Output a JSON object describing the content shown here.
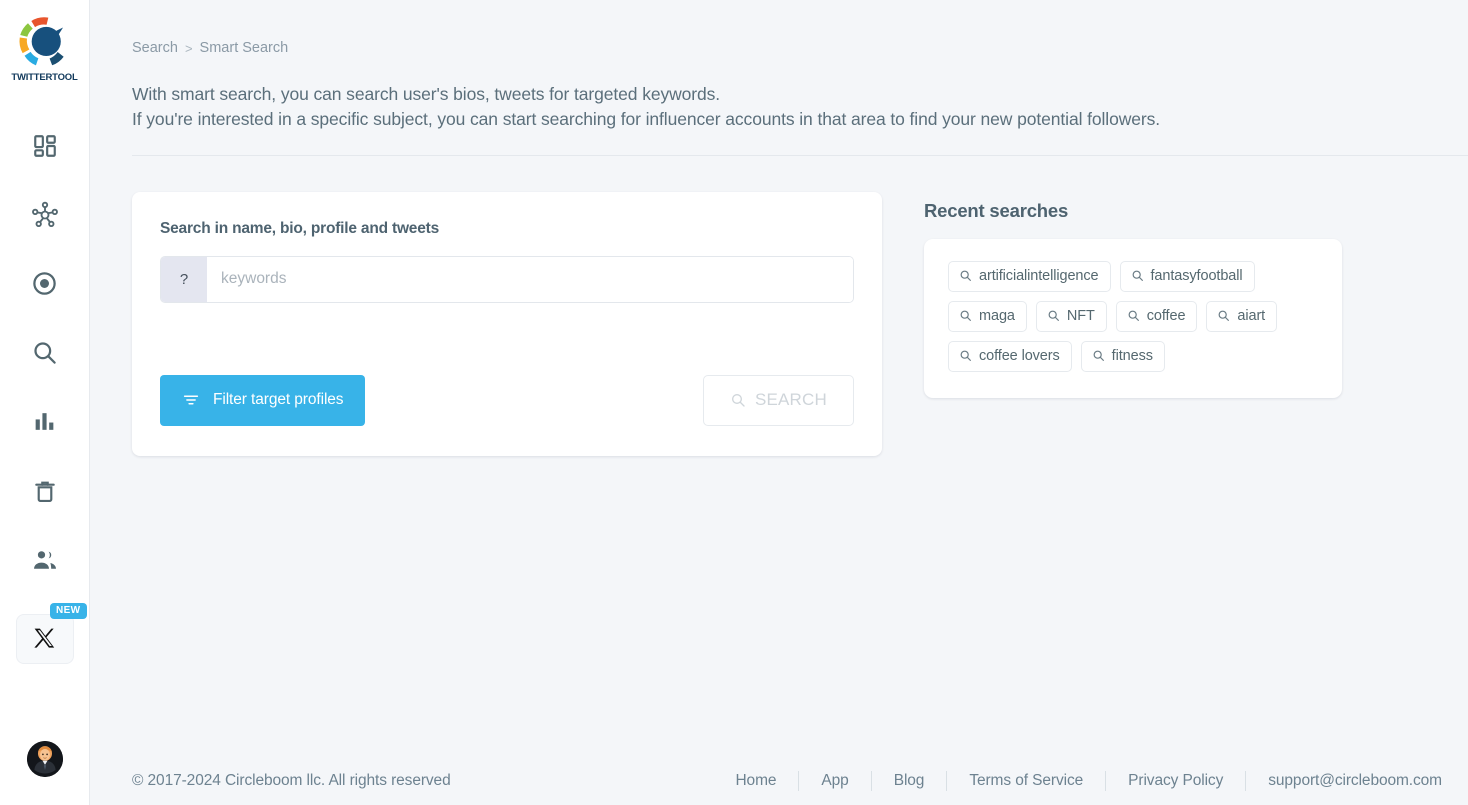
{
  "brand": {
    "name": "TWITTERTOOL",
    "logo_colors": [
      "#e8552d",
      "#8cc63f",
      "#f7a823",
      "#29abe2",
      "#1b4f72"
    ]
  },
  "sidebar": {
    "items": [
      {
        "icon": "grid-dashboard-icon",
        "name": "dashboard"
      },
      {
        "icon": "network-share-icon",
        "name": "network"
      },
      {
        "icon": "target-circle-icon",
        "name": "target"
      },
      {
        "icon": "search-icon",
        "name": "search"
      },
      {
        "icon": "bar-chart-icon",
        "name": "analytics"
      },
      {
        "icon": "trash-icon",
        "name": "cleanup"
      },
      {
        "icon": "users-icon",
        "name": "accounts"
      }
    ],
    "x_item": {
      "icon": "x-logo-icon",
      "badge": "NEW"
    },
    "avatar": {
      "icon": "user-avatar"
    }
  },
  "breadcrumb": {
    "root": "Search",
    "separator": ">",
    "current": "Smart Search"
  },
  "intro": {
    "line1": "With smart search, you can search user's bios, tweets for targeted keywords.",
    "line2": "If you're interested in a specific subject, you can start searching for influencer accounts in that area to find your new potential followers."
  },
  "search_card": {
    "title": "Search in name, bio, profile and tweets",
    "prefix_symbol": "?",
    "input_value": "",
    "input_placeholder": "keywords",
    "filter_button": "Filter target profiles",
    "search_button": "SEARCH"
  },
  "recent": {
    "title": "Recent searches",
    "tags": [
      "artificialintelligence",
      "fantasyfootball",
      "maga",
      "NFT",
      "coffee",
      "aiart",
      "coffee lovers",
      "fitness"
    ]
  },
  "footer": {
    "copyright": "© 2017-2024 Circleboom llc. All rights reserved",
    "links": [
      "Home",
      "App",
      "Blog",
      "Terms of Service",
      "Privacy Policy",
      "support@circleboom.com"
    ]
  },
  "colors": {
    "accent": "#38b3e8",
    "page_bg": "#f4f6f9",
    "text": "#5b6f7b",
    "muted": "#8b9aa6"
  }
}
